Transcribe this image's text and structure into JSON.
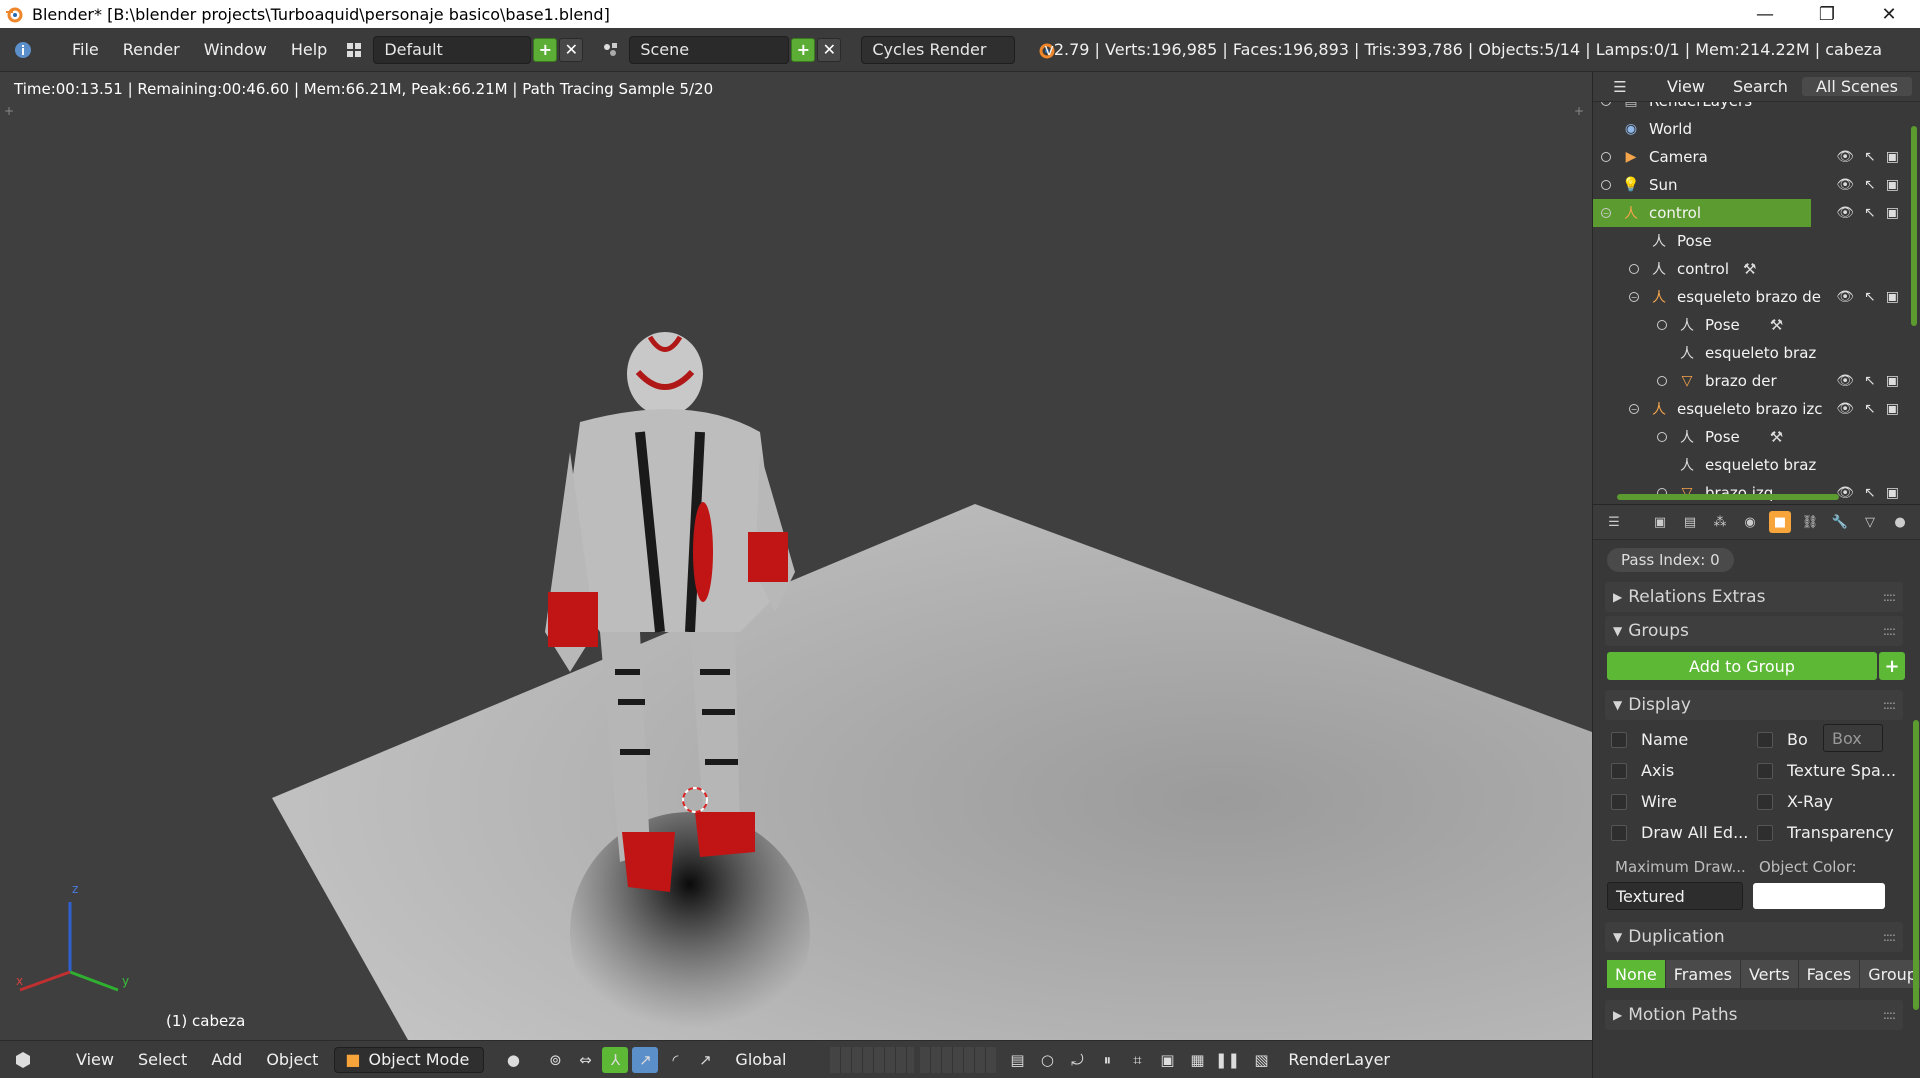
{
  "window": {
    "title": "Blender* [B:\\blender projects\\Turboaquid\\personaje basico\\base1.blend]",
    "minimize": "—",
    "maximize": "❐",
    "close": "✕"
  },
  "menubar": {
    "items": [
      "File",
      "Render",
      "Window",
      "Help"
    ],
    "layout": "Default",
    "scene": "Scene",
    "engine": "Cycles Render",
    "stats": "v2.79 | Verts:196,985 | Faces:196,893 | Tris:393,786 | Objects:5/14 | Lamps:0/1 | Mem:214.22M | cabeza"
  },
  "viewport": {
    "render_info": "Time:00:13.51 | Remaining:00:46.60 | Mem:66.21M, Peak:66.21M | Path Tracing Sample 5/20",
    "object_name": "(1) cabeza",
    "axes": {
      "x": "x",
      "y": "y",
      "z": "z"
    }
  },
  "bottombar": {
    "items": [
      "View",
      "Select",
      "Add",
      "Object"
    ],
    "mode": "Object Mode",
    "orientation": "Global",
    "render_layer": "RenderLayer"
  },
  "outliner": {
    "tabs": [
      "View",
      "Search",
      "All Scenes"
    ],
    "rows": [
      {
        "label": "RenderLayers",
        "icon": "renderlayers-icon",
        "indent": 0
      },
      {
        "label": "World",
        "icon": "world-icon",
        "indent": 0
      },
      {
        "label": "Camera",
        "icon": "camera-icon",
        "indent": 0
      },
      {
        "label": "Sun",
        "icon": "lamp-icon",
        "indent": 0
      },
      {
        "label": "control",
        "icon": "armature-icon",
        "indent": 0,
        "selected": true
      },
      {
        "label": "Pose",
        "icon": "pose-icon",
        "indent": 1
      },
      {
        "label": "control",
        "icon": "armature-data-icon",
        "indent": 1
      },
      {
        "label": "esqueleto brazo de",
        "icon": "armature-icon",
        "indent": 1
      },
      {
        "label": "Pose",
        "icon": "pose-icon",
        "indent": 2
      },
      {
        "label": "esqueleto braz",
        "icon": "armature-data-icon",
        "indent": 2
      },
      {
        "label": "brazo der",
        "icon": "mesh-icon",
        "indent": 2
      },
      {
        "label": "esqueleto brazo izc",
        "icon": "armature-icon",
        "indent": 1
      },
      {
        "label": "Pose",
        "icon": "pose-icon",
        "indent": 2
      },
      {
        "label": "esqueleto braz",
        "icon": "armature-data-icon",
        "indent": 2
      },
      {
        "label": "brazo izq",
        "icon": "mesh-icon",
        "indent": 2
      }
    ]
  },
  "properties": {
    "pass_index": "Pass Index: 0",
    "relations_extras": "Relations Extras",
    "groups": "Groups",
    "add_to_group": "Add to Group",
    "display": "Display",
    "chk_name": "Name",
    "chk_bo": "Bo",
    "box_select": "Box",
    "chk_axis": "Axis",
    "chk_texture_space": "Texture Spa...",
    "chk_wire": "Wire",
    "chk_xray": "X-Ray",
    "chk_draw_all_edges": "Draw All Ed...",
    "chk_transparency": "Transparency",
    "max_draw_label": "Maximum Draw...",
    "object_color_label": "Object Color:",
    "max_draw_value": "Textured",
    "object_color": "#ffffff",
    "duplication": "Duplication",
    "dup_options": [
      "None",
      "Frames",
      "Verts",
      "Faces",
      "Group"
    ],
    "dup_selected": "None",
    "motion_paths": "Motion Paths"
  },
  "colors": {
    "accent_green": "#5cb835",
    "selected_row": "#5c9b2f",
    "object_tab_orange": "#f7a43a"
  }
}
